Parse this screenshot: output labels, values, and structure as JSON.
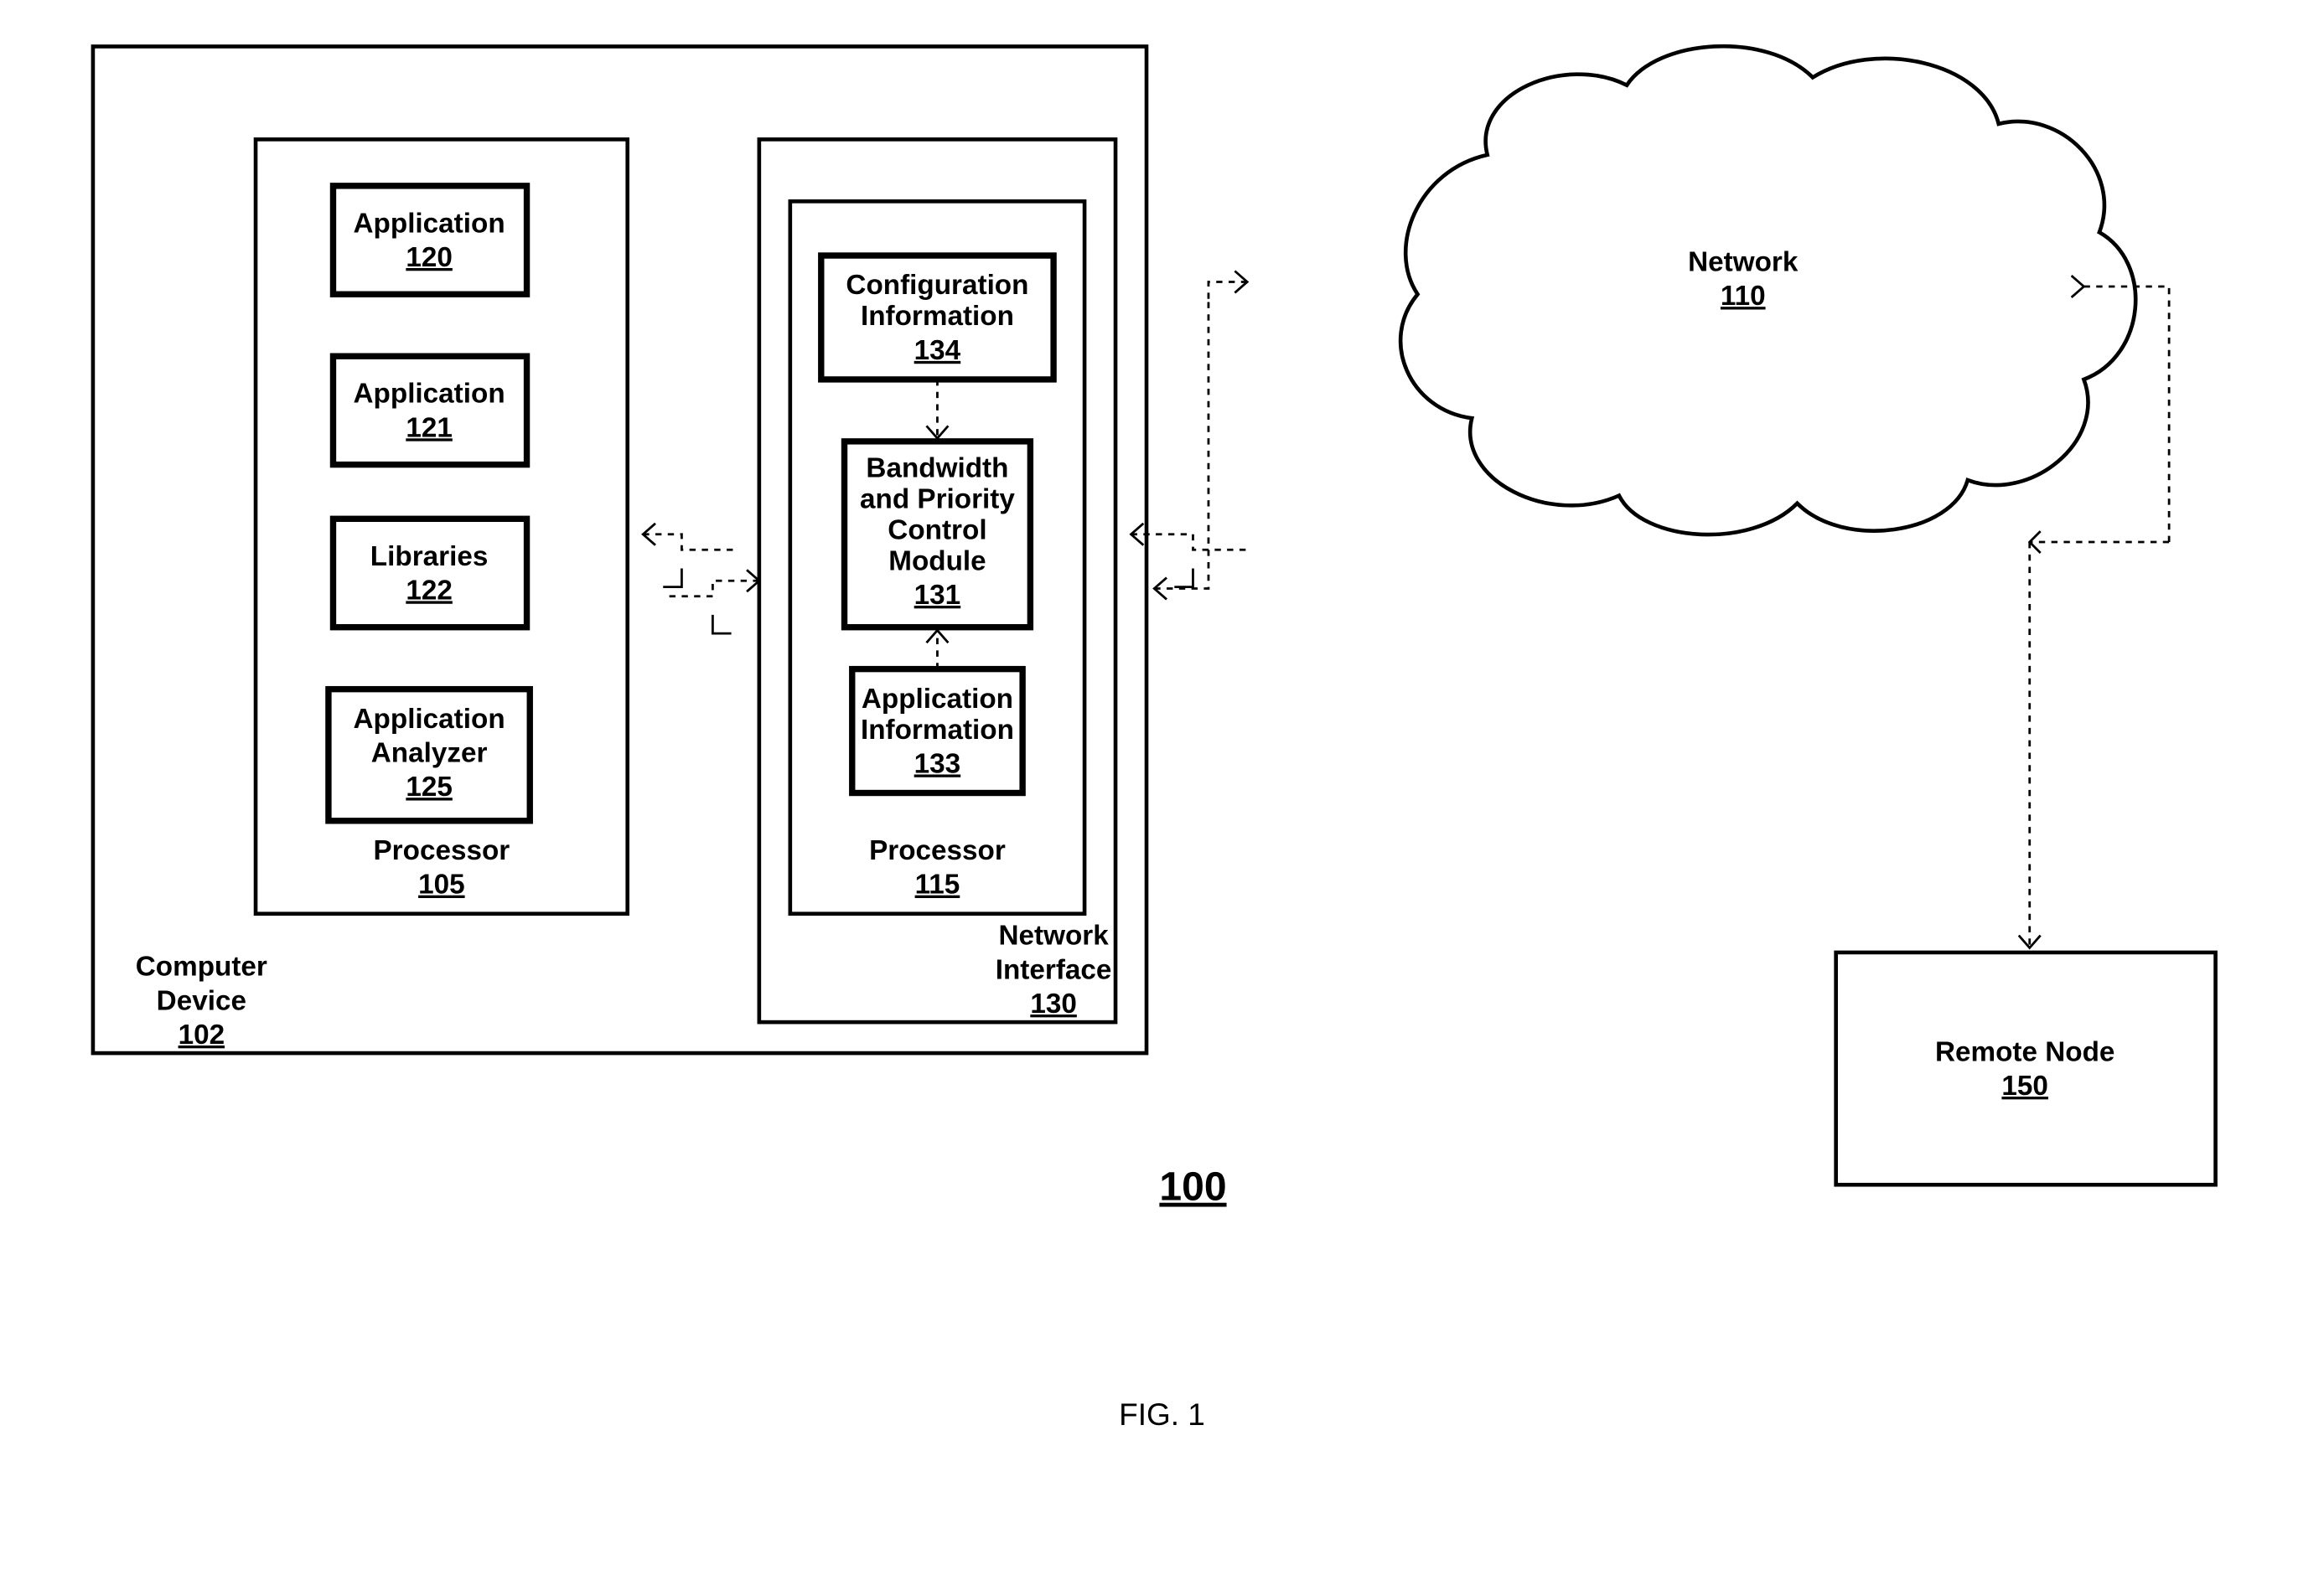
{
  "figure": {
    "caption": "FIG. 1",
    "ref": "100"
  },
  "computer_device": {
    "label": "Computer",
    "label2": "Device",
    "ref": "102"
  },
  "processor105": {
    "label": "Processor",
    "ref": "105",
    "app120": {
      "label": "Application",
      "ref": "120"
    },
    "app121": {
      "label": "Application",
      "ref": "121"
    },
    "libs": {
      "label": "Libraries",
      "ref": "122"
    },
    "analyzer": {
      "label1": "Application",
      "label2": "Analyzer",
      "ref": "125"
    }
  },
  "network_interface": {
    "label1": "Network",
    "label2": "Interface",
    "ref": "130",
    "processor115": {
      "label": "Processor",
      "ref": "115",
      "config": {
        "label1": "Configuration",
        "label2": "Information",
        "ref": "134"
      },
      "module": {
        "label1": "Bandwidth",
        "label2": "and Priority",
        "label3": "Control",
        "label4": "Module",
        "ref": "131"
      },
      "appinfo": {
        "label1": "Application",
        "label2": "Information",
        "ref": "133"
      }
    }
  },
  "network": {
    "label": "Network",
    "ref": "110"
  },
  "remote": {
    "label": "Remote Node",
    "ref": "150"
  }
}
